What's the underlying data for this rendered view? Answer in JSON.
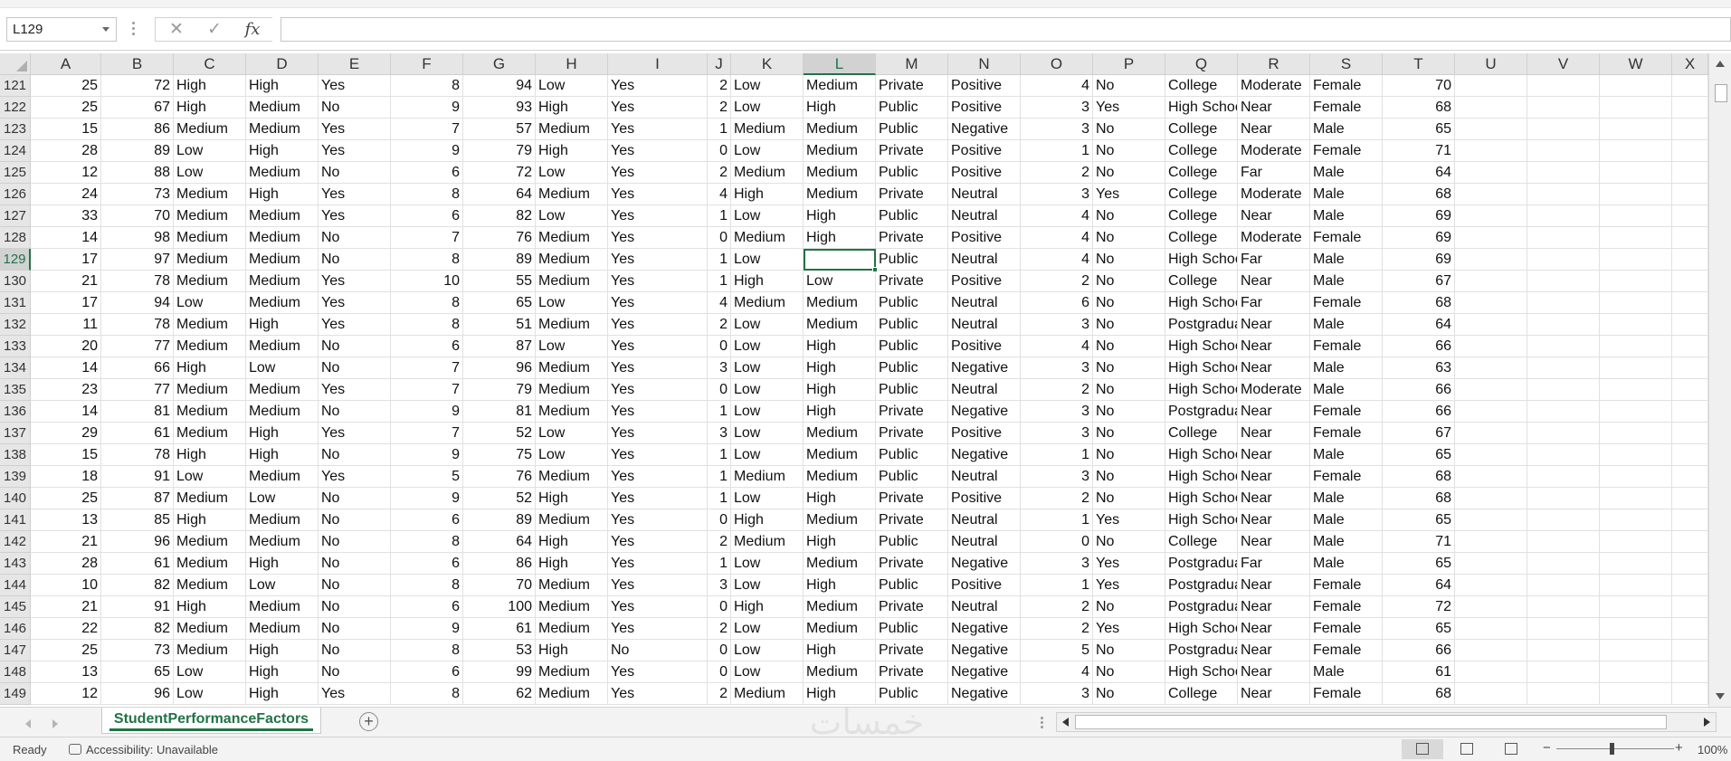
{
  "name_box": "L129",
  "formula_bar": {
    "cancel_icon": "✕",
    "enter_icon": "✓",
    "function_label": "fx",
    "content": ""
  },
  "columns": [
    "A",
    "B",
    "C",
    "D",
    "E",
    "F",
    "G",
    "H",
    "I",
    "J",
    "K",
    "L",
    "M",
    "N",
    "O",
    "P",
    "Q",
    "R",
    "S",
    "T",
    "U",
    "V",
    "W",
    "X"
  ],
  "selected_column": "L",
  "selected_row": "129",
  "rows": [
    {
      "row": "121",
      "c": [
        "25",
        "72",
        "High",
        "High",
        "Yes",
        "8",
        "94",
        "Low",
        "Yes",
        "2",
        "Low",
        "Medium",
        "Private",
        "Positive",
        "4",
        "No",
        "College",
        "Moderate",
        "Female",
        "70"
      ]
    },
    {
      "row": "122",
      "c": [
        "25",
        "67",
        "High",
        "Medium",
        "No",
        "9",
        "93",
        "High",
        "Yes",
        "2",
        "Low",
        "High",
        "Public",
        "Positive",
        "3",
        "Yes",
        "High School",
        "Near",
        "Female",
        "68"
      ]
    },
    {
      "row": "123",
      "c": [
        "15",
        "86",
        "Medium",
        "Medium",
        "Yes",
        "7",
        "57",
        "Medium",
        "Yes",
        "1",
        "Medium",
        "Medium",
        "Public",
        "Negative",
        "3",
        "No",
        "College",
        "Near",
        "Male",
        "65"
      ]
    },
    {
      "row": "124",
      "c": [
        "28",
        "89",
        "Low",
        "High",
        "Yes",
        "9",
        "79",
        "High",
        "Yes",
        "0",
        "Low",
        "Medium",
        "Private",
        "Positive",
        "1",
        "No",
        "College",
        "Moderate",
        "Female",
        "71"
      ]
    },
    {
      "row": "125",
      "c": [
        "12",
        "88",
        "Low",
        "Medium",
        "No",
        "6",
        "72",
        "Low",
        "Yes",
        "2",
        "Medium",
        "Medium",
        "Public",
        "Positive",
        "2",
        "No",
        "College",
        "Far",
        "Male",
        "64"
      ]
    },
    {
      "row": "126",
      "c": [
        "24",
        "73",
        "Medium",
        "High",
        "Yes",
        "8",
        "64",
        "Medium",
        "Yes",
        "4",
        "High",
        "Medium",
        "Private",
        "Neutral",
        "3",
        "Yes",
        "College",
        "Moderate",
        "Male",
        "68"
      ]
    },
    {
      "row": "127",
      "c": [
        "33",
        "70",
        "Medium",
        "Medium",
        "Yes",
        "6",
        "82",
        "Low",
        "Yes",
        "1",
        "Low",
        "High",
        "Public",
        "Neutral",
        "4",
        "No",
        "College",
        "Near",
        "Male",
        "69"
      ]
    },
    {
      "row": "128",
      "c": [
        "14",
        "98",
        "Medium",
        "Medium",
        "No",
        "7",
        "76",
        "Medium",
        "Yes",
        "0",
        "Medium",
        "High",
        "Private",
        "Positive",
        "4",
        "No",
        "College",
        "Moderate",
        "Female",
        "69"
      ]
    },
    {
      "row": "129",
      "c": [
        "17",
        "97",
        "Medium",
        "Medium",
        "No",
        "8",
        "89",
        "Medium",
        "Yes",
        "1",
        "Low",
        "",
        "Public",
        "Neutral",
        "4",
        "No",
        "High School",
        "Far",
        "Male",
        "69"
      ]
    },
    {
      "row": "130",
      "c": [
        "21",
        "78",
        "Medium",
        "Medium",
        "Yes",
        "10",
        "55",
        "Medium",
        "Yes",
        "1",
        "High",
        "Low",
        "Private",
        "Positive",
        "2",
        "No",
        "College",
        "Near",
        "Male",
        "67"
      ]
    },
    {
      "row": "131",
      "c": [
        "17",
        "94",
        "Low",
        "Medium",
        "Yes",
        "8",
        "65",
        "Low",
        "Yes",
        "4",
        "Medium",
        "Medium",
        "Public",
        "Neutral",
        "6",
        "No",
        "High School",
        "Far",
        "Female",
        "68"
      ]
    },
    {
      "row": "132",
      "c": [
        "11",
        "78",
        "Medium",
        "High",
        "Yes",
        "8",
        "51",
        "Medium",
        "Yes",
        "2",
        "Low",
        "Medium",
        "Public",
        "Neutral",
        "3",
        "No",
        "Postgraduate",
        "Near",
        "Male",
        "64"
      ]
    },
    {
      "row": "133",
      "c": [
        "20",
        "77",
        "Medium",
        "Medium",
        "No",
        "6",
        "87",
        "Low",
        "Yes",
        "0",
        "Low",
        "High",
        "Public",
        "Positive",
        "4",
        "No",
        "High School",
        "Near",
        "Female",
        "66"
      ]
    },
    {
      "row": "134",
      "c": [
        "14",
        "66",
        "High",
        "Low",
        "No",
        "7",
        "96",
        "Medium",
        "Yes",
        "3",
        "Low",
        "High",
        "Public",
        "Negative",
        "3",
        "No",
        "High School",
        "Near",
        "Male",
        "63"
      ]
    },
    {
      "row": "135",
      "c": [
        "23",
        "77",
        "Medium",
        "Medium",
        "Yes",
        "7",
        "79",
        "Medium",
        "Yes",
        "0",
        "Low",
        "High",
        "Public",
        "Neutral",
        "2",
        "No",
        "High School",
        "Moderate",
        "Male",
        "66"
      ]
    },
    {
      "row": "136",
      "c": [
        "14",
        "81",
        "Medium",
        "Medium",
        "No",
        "9",
        "81",
        "Medium",
        "Yes",
        "1",
        "Low",
        "High",
        "Private",
        "Negative",
        "3",
        "No",
        "Postgraduate",
        "Near",
        "Female",
        "66"
      ]
    },
    {
      "row": "137",
      "c": [
        "29",
        "61",
        "Medium",
        "High",
        "Yes",
        "7",
        "52",
        "Low",
        "Yes",
        "3",
        "Low",
        "Medium",
        "Private",
        "Positive",
        "3",
        "No",
        "College",
        "Near",
        "Female",
        "67"
      ]
    },
    {
      "row": "138",
      "c": [
        "15",
        "78",
        "High",
        "High",
        "No",
        "9",
        "75",
        "Low",
        "Yes",
        "1",
        "Low",
        "Medium",
        "Public",
        "Negative",
        "1",
        "No",
        "High School",
        "Near",
        "Male",
        "65"
      ]
    },
    {
      "row": "139",
      "c": [
        "18",
        "91",
        "Low",
        "Medium",
        "Yes",
        "5",
        "76",
        "Medium",
        "Yes",
        "1",
        "Medium",
        "Medium",
        "Public",
        "Neutral",
        "3",
        "No",
        "High School",
        "Near",
        "Female",
        "68"
      ]
    },
    {
      "row": "140",
      "c": [
        "25",
        "87",
        "Medium",
        "Low",
        "No",
        "9",
        "52",
        "High",
        "Yes",
        "1",
        "Low",
        "High",
        "Private",
        "Positive",
        "2",
        "No",
        "High School",
        "Near",
        "Male",
        "68"
      ]
    },
    {
      "row": "141",
      "c": [
        "13",
        "85",
        "High",
        "Medium",
        "No",
        "6",
        "89",
        "Medium",
        "Yes",
        "0",
        "High",
        "Medium",
        "Private",
        "Neutral",
        "1",
        "Yes",
        "High School",
        "Near",
        "Male",
        "65"
      ]
    },
    {
      "row": "142",
      "c": [
        "21",
        "96",
        "Medium",
        "Medium",
        "No",
        "8",
        "64",
        "High",
        "Yes",
        "2",
        "Medium",
        "High",
        "Public",
        "Neutral",
        "0",
        "No",
        "College",
        "Near",
        "Male",
        "71"
      ]
    },
    {
      "row": "143",
      "c": [
        "28",
        "61",
        "Medium",
        "High",
        "No",
        "6",
        "86",
        "High",
        "Yes",
        "1",
        "Low",
        "Medium",
        "Private",
        "Negative",
        "3",
        "Yes",
        "Postgraduate",
        "Far",
        "Male",
        "65"
      ]
    },
    {
      "row": "144",
      "c": [
        "10",
        "82",
        "Medium",
        "Low",
        "No",
        "8",
        "70",
        "Medium",
        "Yes",
        "3",
        "Low",
        "High",
        "Public",
        "Positive",
        "1",
        "Yes",
        "Postgraduate",
        "Near",
        "Female",
        "64"
      ]
    },
    {
      "row": "145",
      "c": [
        "21",
        "91",
        "High",
        "Medium",
        "No",
        "6",
        "100",
        "Medium",
        "Yes",
        "0",
        "High",
        "Medium",
        "Private",
        "Neutral",
        "2",
        "No",
        "Postgraduate",
        "Near",
        "Female",
        "72"
      ]
    },
    {
      "row": "146",
      "c": [
        "22",
        "82",
        "Medium",
        "Medium",
        "No",
        "9",
        "61",
        "Medium",
        "Yes",
        "2",
        "Low",
        "Medium",
        "Public",
        "Negative",
        "2",
        "Yes",
        "High School",
        "Near",
        "Female",
        "65"
      ]
    },
    {
      "row": "147",
      "c": [
        "25",
        "73",
        "Medium",
        "High",
        "No",
        "8",
        "53",
        "High",
        "No",
        "0",
        "Low",
        "High",
        "Private",
        "Negative",
        "5",
        "No",
        "Postgraduate",
        "Near",
        "Female",
        "66"
      ]
    },
    {
      "row": "148",
      "c": [
        "13",
        "65",
        "Low",
        "High",
        "No",
        "6",
        "99",
        "Medium",
        "Yes",
        "0",
        "Low",
        "Medium",
        "Private",
        "Negative",
        "4",
        "No",
        "High School",
        "Near",
        "Male",
        "61"
      ]
    },
    {
      "row": "149",
      "c": [
        "12",
        "96",
        "Low",
        "High",
        "Yes",
        "8",
        "62",
        "Medium",
        "Yes",
        "2",
        "Medium",
        "High",
        "Public",
        "Negative",
        "3",
        "No",
        "College",
        "Near",
        "Female",
        "68"
      ]
    }
  ],
  "sheet_tab": "StudentPerformanceFactors",
  "add_sheet_icon": "+",
  "status": {
    "ready": "Ready",
    "accessibility": "Accessibility: Unavailable",
    "zoom_minus": "−",
    "zoom_plus": "+",
    "zoom": "100%"
  },
  "watermark": "خمسات",
  "accent_color": "#217346"
}
